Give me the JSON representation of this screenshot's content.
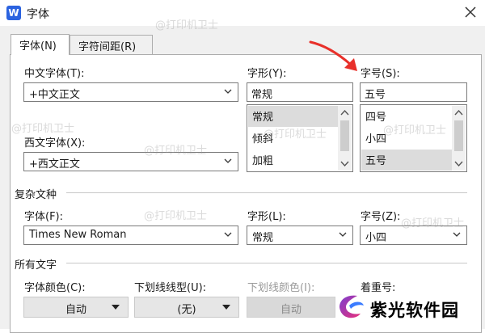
{
  "window": {
    "app_icon_letter": "W",
    "title": "字体"
  },
  "tabs": [
    {
      "label": "字体(N)",
      "active": true
    },
    {
      "label": "字符间距(R)",
      "active": false
    }
  ],
  "chinese_font": {
    "label": "中文字体(T):",
    "value": "+中文正文"
  },
  "western_font": {
    "label": "西文字体(X):",
    "value": "+西文正文"
  },
  "style": {
    "label": "字形(Y):",
    "value": "常规",
    "items": [
      "常规",
      "倾斜",
      "加粗"
    ],
    "selected_index": 0
  },
  "size": {
    "label": "字号(S):",
    "value": "五号",
    "items": [
      "四号",
      "小四",
      "五号"
    ],
    "selected_index": 2
  },
  "complex_section": {
    "title": "复杂文种",
    "font_label": "字体(F):",
    "font_value": "Times New Roman",
    "style_label": "字形(L):",
    "style_value": "常规",
    "size_label": "字号(Z):",
    "size_value": "小四"
  },
  "all_text_section": {
    "title": "所有文字",
    "font_color_label": "字体颜色(C):",
    "font_color_value": "自动",
    "underline_type_label": "下划线线型(U):",
    "underline_type_value": "(无)",
    "underline_color_label": "下划线颜色(I):",
    "underline_color_value": "自动",
    "emphasis_label": "着重号:"
  },
  "watermarks": [
    "@打印机卫士",
    "@打印机卫士",
    "@打印机卫士",
    "@打印机卫士",
    "@打印机卫士",
    "@打印机卫士",
    "@打印机卫士"
  ],
  "brand_logo_text": "紫光软件园",
  "colors": {
    "accent_blue": "#2b63e0",
    "arrow_red": "#e8302a",
    "logo_purple": "#7b3fd0",
    "logo_pink": "#e8307a"
  }
}
